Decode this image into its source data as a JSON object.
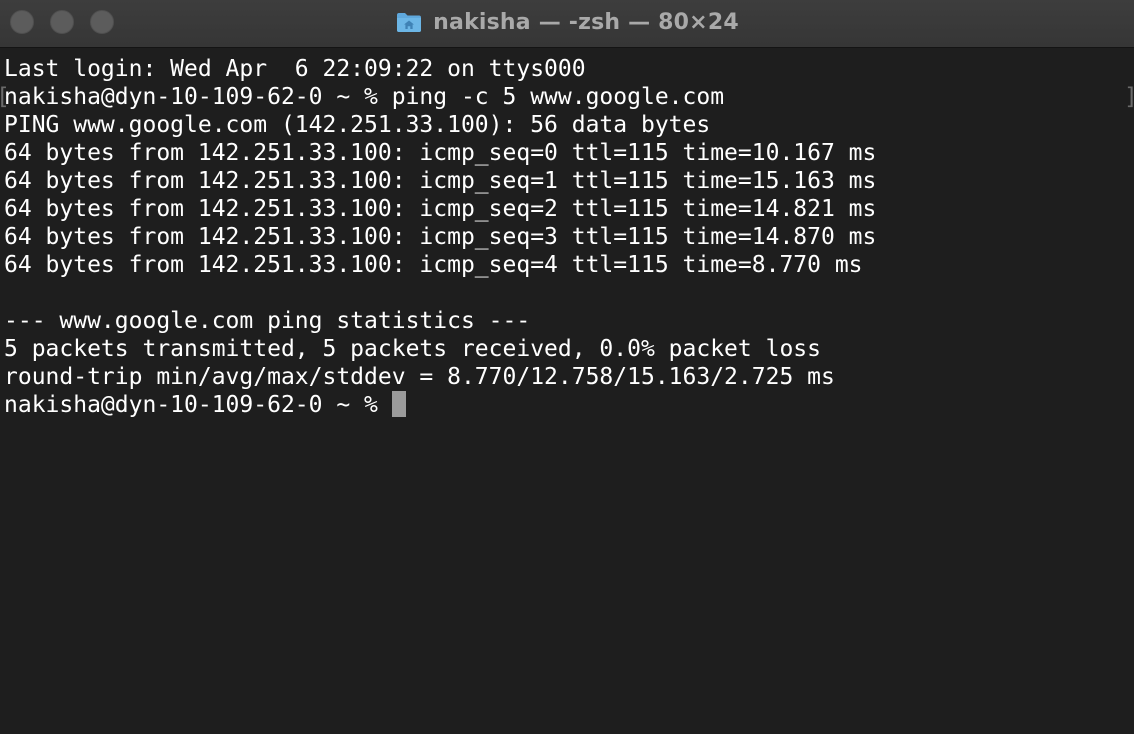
{
  "window": {
    "title": "nakisha — -zsh — 80×24",
    "title_icon": "folder-home-icon"
  },
  "terminal": {
    "lines": [
      "Last login: Wed Apr  6 22:09:22 on ttys000",
      "nakisha@dyn-10-109-62-0 ~ % ping -c 5 www.google.com",
      "PING www.google.com (142.251.33.100): 56 data bytes",
      "64 bytes from 142.251.33.100: icmp_seq=0 ttl=115 time=10.167 ms",
      "64 bytes from 142.251.33.100: icmp_seq=1 ttl=115 time=15.163 ms",
      "64 bytes from 142.251.33.100: icmp_seq=2 ttl=115 time=14.821 ms",
      "64 bytes from 142.251.33.100: icmp_seq=3 ttl=115 time=14.870 ms",
      "64 bytes from 142.251.33.100: icmp_seq=4 ttl=115 time=8.770 ms",
      "",
      "--- www.google.com ping statistics ---",
      "5 packets transmitted, 5 packets received, 0.0% packet loss",
      "round-trip min/avg/max/stddev = 8.770/12.758/15.163/2.725 ms",
      "nakisha@dyn-10-109-62-0 ~ % "
    ],
    "mark_left": "[",
    "mark_right": "]"
  },
  "colors": {
    "background": "#1e1e1e",
    "text": "#ffffff",
    "cursor": "#9b9b9b",
    "titlebar": "#3a3a3a",
    "folder": "#5fa8dc"
  }
}
